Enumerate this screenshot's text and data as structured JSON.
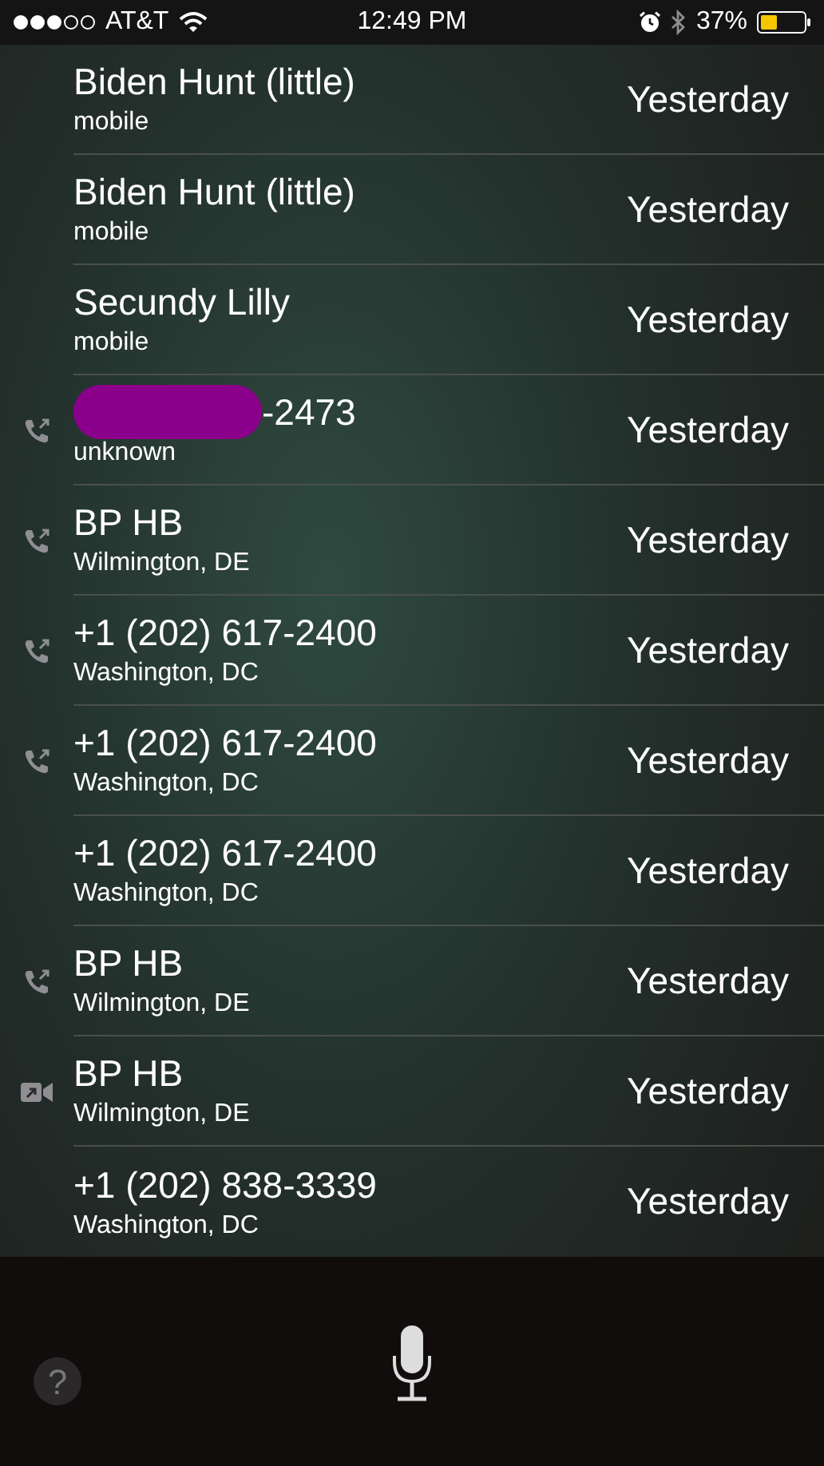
{
  "status_bar": {
    "carrier": "AT&T",
    "time": "12:49 PM",
    "battery_percent": "37%"
  },
  "calls": [
    {
      "kind": "plain",
      "redacted": false,
      "name": "Biden Hunt (little)",
      "detail": "mobile",
      "when": "Yesterday"
    },
    {
      "kind": "plain",
      "redacted": false,
      "name": "Biden Hunt (little)",
      "detail": "mobile",
      "when": "Yesterday"
    },
    {
      "kind": "plain",
      "redacted": false,
      "name": "Secundy Lilly",
      "detail": "mobile",
      "when": "Yesterday"
    },
    {
      "kind": "call",
      "redacted": true,
      "name": "-2473",
      "detail": "unknown",
      "when": "Yesterday"
    },
    {
      "kind": "call",
      "redacted": false,
      "name": "BP HB",
      "detail": "Wilmington, DE",
      "when": "Yesterday"
    },
    {
      "kind": "call",
      "redacted": false,
      "name": "+1 (202) 617-2400",
      "detail": "Washington, DC",
      "when": "Yesterday"
    },
    {
      "kind": "call",
      "redacted": false,
      "name": "+1 (202) 617-2400",
      "detail": "Washington, DC",
      "when": "Yesterday"
    },
    {
      "kind": "plain",
      "redacted": false,
      "name": "+1 (202) 617-2400",
      "detail": "Washington, DC",
      "when": "Yesterday"
    },
    {
      "kind": "call",
      "redacted": false,
      "name": "BP HB",
      "detail": "Wilmington, DE",
      "when": "Yesterday"
    },
    {
      "kind": "video",
      "redacted": false,
      "name": "BP HB",
      "detail": "Wilmington, DE",
      "when": "Yesterday"
    },
    {
      "kind": "plain",
      "redacted": false,
      "name": "+1 (202) 838-3339",
      "detail": "Washington, DC",
      "when": "Yesterday"
    }
  ],
  "help_button": "?"
}
